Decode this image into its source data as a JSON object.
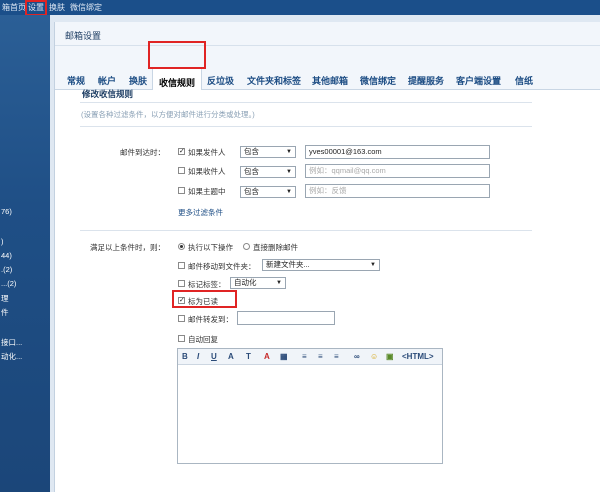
{
  "topbar": {
    "items": [
      "箱首页",
      "设置",
      "换肤",
      "微信绑定"
    ]
  },
  "sidebar": {
    "items": [
      "76)",
      ")",
      "44)",
      ".(2)",
      "...(2)",
      "理",
      "件",
      "接口...",
      "动化..."
    ]
  },
  "panel": {
    "title": "邮箱设置"
  },
  "tabs": [
    {
      "label": "常规"
    },
    {
      "label": "帐户"
    },
    {
      "label": "换肤"
    },
    {
      "label": "收信规则"
    },
    {
      "label": "反垃圾"
    },
    {
      "label": "文件夹和标签"
    },
    {
      "label": "其他邮箱"
    },
    {
      "label": "微信绑定"
    },
    {
      "label": "提醒服务"
    },
    {
      "label": "客户端设置"
    },
    {
      "label": "信纸"
    }
  ],
  "rule": {
    "section_title": "修改收信规则",
    "section_sub": "(设置各种过滤条件，以方便对邮件进行分类或处理。)",
    "when_label": "邮件到达时：",
    "conditions": [
      {
        "label": "如果发件人",
        "checked": true,
        "operator": "包含",
        "value": "yves00001@163.com",
        "placeholder": ""
      },
      {
        "label": "如果收件人",
        "checked": false,
        "operator": "包含",
        "value": "",
        "placeholder": "例如：qqmail@qq.com"
      },
      {
        "label": "如果主题中",
        "checked": false,
        "operator": "包含",
        "value": "",
        "placeholder": "例如：反馈"
      }
    ],
    "more_filters": "更多过滤条件",
    "then_label": "满足以上条件时，则：",
    "radio_execute": "执行以下操作",
    "radio_delete": "直接删除邮件",
    "move_label": "邮件移动到文件夹：",
    "move_value": "新建文件夹...",
    "tag_label": "标记标签：",
    "tag_value": "自动化",
    "mark_read_label": "标为已读",
    "forward_label": "邮件转发到：",
    "auto_reply_label": "自动回复",
    "editor_tools": [
      "B",
      "I",
      "U",
      "A",
      "T",
      "A",
      "▦",
      "≡",
      "≡",
      "≡",
      "∞",
      "☺",
      "▣",
      "<HTML>"
    ]
  },
  "colors": {
    "highlight": "#e02424",
    "topbar": "#1b4f8a",
    "sidebar": "#2b5f96",
    "tab_text": "#1d4d84"
  }
}
